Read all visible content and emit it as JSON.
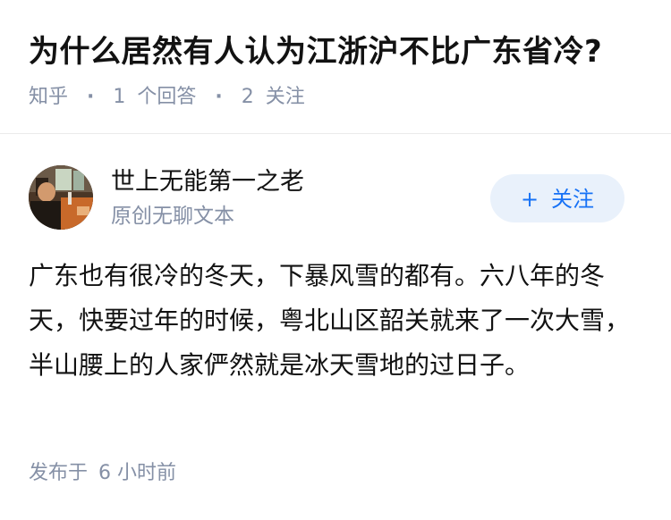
{
  "question": {
    "title": "为什么居然有人认为江浙沪不比广东省冷?",
    "source": "知乎",
    "answer_count": "1",
    "answer_label": "个回答",
    "follow_count": "2",
    "follow_label": "关注"
  },
  "answer": {
    "author_name": "世上无能第一之老",
    "author_bio": "原创无聊文本",
    "follow_button_label": "关注",
    "follow_button_icon": "plus-icon",
    "content": "广东也有很冷的冬天，下暴风雪的都有。六八年的冬天，快要过年的时候，粤北山区韶关就来了一次大雪，半山腰上的人家俨然就是冰天雪地的过日子。",
    "publish_label": "发布于",
    "publish_time": "6 小时前"
  },
  "colors": {
    "meta_gray": "#8590a6",
    "accent_blue": "#1772f6",
    "follow_bg": "#e9f1fb",
    "text": "#121212",
    "divider": "#ebebeb"
  }
}
